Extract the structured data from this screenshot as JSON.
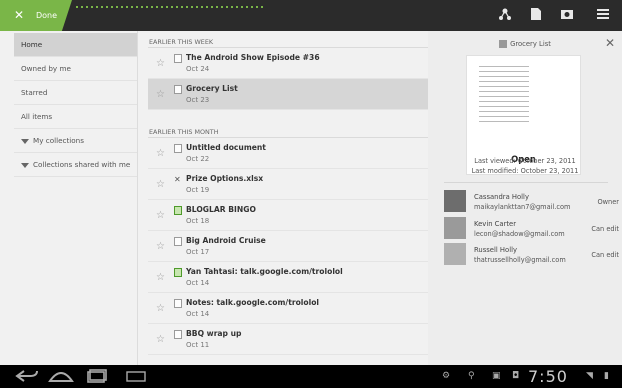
{
  "actionbar": {
    "done_label": "Done",
    "icons": [
      "share-icon",
      "doc-icon",
      "camera-icon",
      "menu-icon"
    ]
  },
  "nav": {
    "items": [
      {
        "label": "Home",
        "selected": true
      },
      {
        "label": "Owned by me"
      },
      {
        "label": "Starred"
      },
      {
        "label": "All items"
      },
      {
        "label": "My collections",
        "expandable": true
      },
      {
        "label": "Collections shared with me",
        "expandable": true
      }
    ]
  },
  "list": {
    "sections": [
      {
        "label": "EARLIER THIS WEEK",
        "items": [
          {
            "title": "The Android Show Episode #36",
            "date": "Oct 24",
            "icon": "document-icon"
          },
          {
            "title": "Grocery List",
            "date": "Oct 23",
            "icon": "document-icon",
            "selected": true
          }
        ]
      },
      {
        "label": "EARLIER THIS MONTH",
        "items": [
          {
            "title": "Untitled document",
            "date": "Oct 22",
            "icon": "document-icon"
          },
          {
            "title": "Prize Options.xlsx",
            "date": "Oct 19",
            "icon": "excel-icon"
          },
          {
            "title": "BLOGLAR BINGO",
            "date": "Oct 18",
            "icon": "spreadsheet-icon"
          },
          {
            "title": "Big Android Cruise",
            "date": "Oct 17",
            "icon": "document-icon"
          },
          {
            "title": "Yan Tahtasi: talk.google.com/trololol",
            "date": "Oct 14",
            "icon": "spreadsheet-icon"
          },
          {
            "title": "Notes: talk.google.com/trololol",
            "date": "Oct 14",
            "icon": "document-icon"
          },
          {
            "title": "BBQ wrap up",
            "date": "Oct 11",
            "icon": "document-icon"
          }
        ]
      }
    ]
  },
  "detail": {
    "title": "Grocery List",
    "open_label": "Open",
    "last_viewed": "Last viewed: October 23, 2011",
    "last_modified": "Last modified: October 23, 2011",
    "people": [
      {
        "name": "Cassandra Holly",
        "email": "maikaylankttan7@gmail.com",
        "role": "Owner"
      },
      {
        "name": "Kevin Carter",
        "email": "lecon@shadow@gmail.com",
        "role": "Can edit"
      },
      {
        "name": "Russell Holly",
        "email": "thatrussellholly@gmail.com",
        "role": "Can edit"
      }
    ]
  },
  "sysbar": {
    "time": "7:50"
  }
}
